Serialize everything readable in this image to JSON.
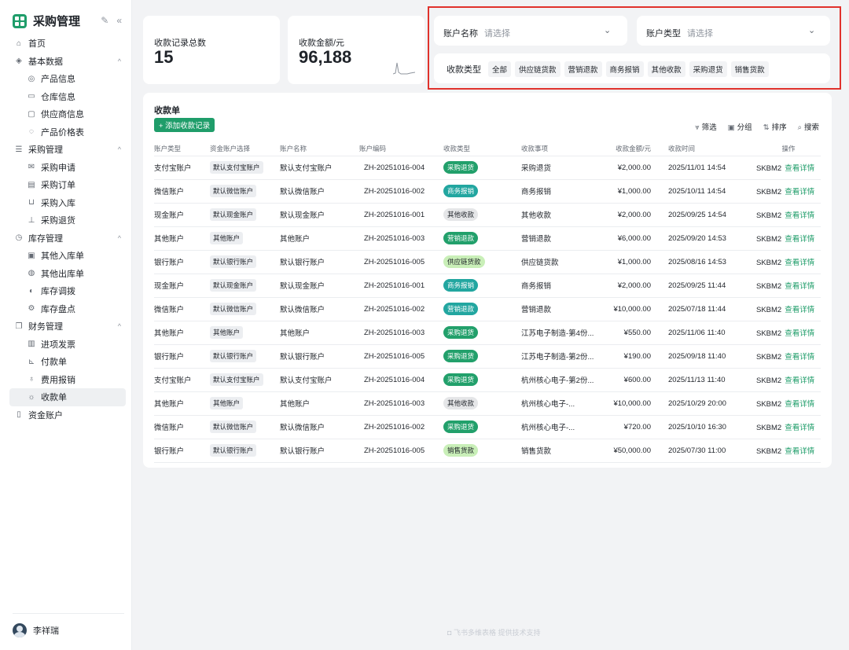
{
  "app": {
    "title": "采购管理",
    "edit_glyph": "✎",
    "collapse_glyph": "«"
  },
  "sidebar": {
    "items": [
      {
        "label": "首页",
        "icon": "home-icon",
        "glyph": "⌂",
        "level": 0
      },
      {
        "label": "基本数据",
        "icon": "layers-icon",
        "glyph": "◈",
        "level": 0,
        "group": true
      },
      {
        "label": "产品信息",
        "icon": "globe-icon",
        "glyph": "◎",
        "level": 1
      },
      {
        "label": "仓库信息",
        "icon": "folder-icon",
        "glyph": "▭",
        "level": 1
      },
      {
        "label": "供应商信息",
        "icon": "monitor-icon",
        "glyph": "▢",
        "level": 1
      },
      {
        "label": "产品价格表",
        "icon": "price-icon",
        "glyph": "◌",
        "level": 1
      },
      {
        "label": "采购管理",
        "icon": "list-icon",
        "glyph": "☰",
        "level": 0,
        "group": true
      },
      {
        "label": "采购申请",
        "icon": "mail-icon",
        "glyph": "✉",
        "level": 1
      },
      {
        "label": "采购订单",
        "icon": "calendar-icon",
        "glyph": "▤",
        "level": 1
      },
      {
        "label": "采购入库",
        "icon": "inbox-icon",
        "glyph": "⊔",
        "level": 1
      },
      {
        "label": "采购退货",
        "icon": "return-icon",
        "glyph": "⊥",
        "level": 1
      },
      {
        "label": "库存管理",
        "icon": "clock-icon",
        "glyph": "◷",
        "level": 0,
        "group": true
      },
      {
        "label": "其他入库单",
        "icon": "inbound-icon",
        "glyph": "▣",
        "level": 1
      },
      {
        "label": "其他出库单",
        "icon": "outbound-icon",
        "glyph": "◍",
        "level": 1
      },
      {
        "label": "库存调拨",
        "icon": "transfer-icon",
        "glyph": "◐",
        "level": 1
      },
      {
        "label": "库存盘点",
        "icon": "gear-icon",
        "glyph": "⚙",
        "level": 1
      },
      {
        "label": "财务管理",
        "icon": "copy-icon",
        "glyph": "❐",
        "level": 0,
        "group": true
      },
      {
        "label": "进项发票",
        "icon": "barcode-icon",
        "glyph": "▥",
        "level": 1
      },
      {
        "label": "付款单",
        "icon": "chart-icon",
        "glyph": "⊾",
        "level": 1
      },
      {
        "label": "费用报销",
        "icon": "trophy-icon",
        "glyph": "♁",
        "level": 1
      },
      {
        "label": "收款单",
        "icon": "bulb-icon",
        "glyph": "☼",
        "level": 1,
        "active": true
      },
      {
        "label": "资金账户",
        "icon": "bar-chart-icon",
        "glyph": "▯",
        "level": 0
      }
    ],
    "user_name": "李祥瑞"
  },
  "stats": {
    "count_label": "收款记录总数",
    "count_value": "15",
    "amount_label": "收款金额/元",
    "amount_value": "96,188"
  },
  "filters": {
    "account_name_label": "账户名称",
    "account_name_placeholder": "请选择",
    "account_type_label": "账户类型",
    "account_type_placeholder": "请选择",
    "receipt_type_label": "收款类型",
    "tags": [
      "全部",
      "供应链货款",
      "营销退款",
      "商务报销",
      "其他收款",
      "采购退货",
      "销售货款"
    ]
  },
  "table": {
    "title": "收款单",
    "add_label": "+ 添加收款记录",
    "toolbar": [
      {
        "label": "筛选",
        "glyph": "⩔",
        "icon": "filter-icon"
      },
      {
        "label": "分组",
        "glyph": "▣",
        "icon": "group-icon"
      },
      {
        "label": "排序",
        "glyph": "⇅",
        "icon": "sort-icon"
      },
      {
        "label": "搜索",
        "glyph": "⌕",
        "icon": "search-icon"
      }
    ],
    "columns": [
      "账户类型",
      "资金账户选择",
      "账户名称",
      "账户编码",
      "收款类型",
      "收款事项",
      "收款金额/元",
      "收款时间",
      "操作"
    ],
    "detail_label": "查看详情",
    "rows": [
      {
        "type": "支付宝账户",
        "fund": "默认支付宝账户",
        "name": "默认支付宝账户",
        "code": "ZH-20251016-004",
        "rtype": "采购退货",
        "style": "green",
        "item": "采购退货",
        "amount": "¥2,000.00",
        "time": "2025/11/01  14:54",
        "op": "SKBM2"
      },
      {
        "type": "微信账户",
        "fund": "默认微信账户",
        "name": "默认微信账户",
        "code": "ZH-20251016-002",
        "rtype": "商务报销",
        "style": "teal",
        "item": "商务报销",
        "amount": "¥1,000.00",
        "time": "2025/10/11  14:54",
        "op": "SKBM2"
      },
      {
        "type": "现金账户",
        "fund": "默认现金账户",
        "name": "默认现金账户",
        "code": "ZH-20251016-001",
        "rtype": "其他收款",
        "style": "gray",
        "item": "其他收款",
        "amount": "¥2,000.00",
        "time": "2025/09/25  14:54",
        "op": "SKBM2"
      },
      {
        "type": "其他账户",
        "fund": "其他账户",
        "name": "其他账户",
        "code": "ZH-20251016-003",
        "rtype": "营销退款",
        "style": "green",
        "item": "营销退款",
        "amount": "¥6,000.00",
        "time": "2025/09/20  14:53",
        "op": "SKBM2"
      },
      {
        "type": "银行账户",
        "fund": "默认银行账户",
        "name": "默认银行账户",
        "code": "ZH-20251016-005",
        "rtype": "供应链货款",
        "style": "lgreen",
        "item": "供应链货款",
        "amount": "¥1,000.00",
        "time": "2025/08/16  14:53",
        "op": "SKBM2"
      },
      {
        "type": "现金账户",
        "fund": "默认现金账户",
        "name": "默认现金账户",
        "code": "ZH-20251016-001",
        "rtype": "商务报销",
        "style": "teal",
        "item": "商务报销",
        "amount": "¥2,000.00",
        "time": "2025/09/25  11:44",
        "op": "SKBM2"
      },
      {
        "type": "微信账户",
        "fund": "默认微信账户",
        "name": "默认微信账户",
        "code": "ZH-20251016-002",
        "rtype": "营销退款",
        "style": "teal",
        "item": "营销退款",
        "amount": "¥10,000.00",
        "time": "2025/07/18  11:44",
        "op": "SKBM2"
      },
      {
        "type": "其他账户",
        "fund": "其他账户",
        "name": "其他账户",
        "code": "ZH-20251016-003",
        "rtype": "采购退货",
        "style": "green",
        "item": "江苏电子制造-第4份...",
        "amount": "¥550.00",
        "time": "2025/11/06  11:40",
        "op": "SKBM2"
      },
      {
        "type": "银行账户",
        "fund": "默认银行账户",
        "name": "默认银行账户",
        "code": "ZH-20251016-005",
        "rtype": "采购退货",
        "style": "green",
        "item": "江苏电子制造-第2份...",
        "amount": "¥190.00",
        "time": "2025/09/18  11:40",
        "op": "SKBM2"
      },
      {
        "type": "支付宝账户",
        "fund": "默认支付宝账户",
        "name": "默认支付宝账户",
        "code": "ZH-20251016-004",
        "rtype": "采购退货",
        "style": "green",
        "item": "杭州核心电子-第2份...",
        "amount": "¥600.00",
        "time": "2025/11/13  11:40",
        "op": "SKBM2"
      },
      {
        "type": "其他账户",
        "fund": "其他账户",
        "name": "其他账户",
        "code": "ZH-20251016-003",
        "rtype": "其他收款",
        "style": "gray",
        "item": "杭州核心电子-...",
        "amount": "¥10,000.00",
        "time": "2025/10/29  20:00",
        "op": "SKBM2"
      },
      {
        "type": "微信账户",
        "fund": "默认微信账户",
        "name": "默认微信账户",
        "code": "ZH-20251016-002",
        "rtype": "采购退货",
        "style": "green",
        "item": "杭州核心电子-...",
        "amount": "¥720.00",
        "time": "2025/10/10  16:30",
        "op": "SKBM2"
      },
      {
        "type": "银行账户",
        "fund": "默认银行账户",
        "name": "默认银行账户",
        "code": "ZH-20251016-005",
        "rtype": "销售货款",
        "style": "lgreen",
        "item": "销售货款",
        "amount": "¥50,000.00",
        "time": "2025/07/30  11:00",
        "op": "SKBM2"
      }
    ]
  },
  "footer": {
    "note": "飞书多维表格 提供技术支持"
  }
}
